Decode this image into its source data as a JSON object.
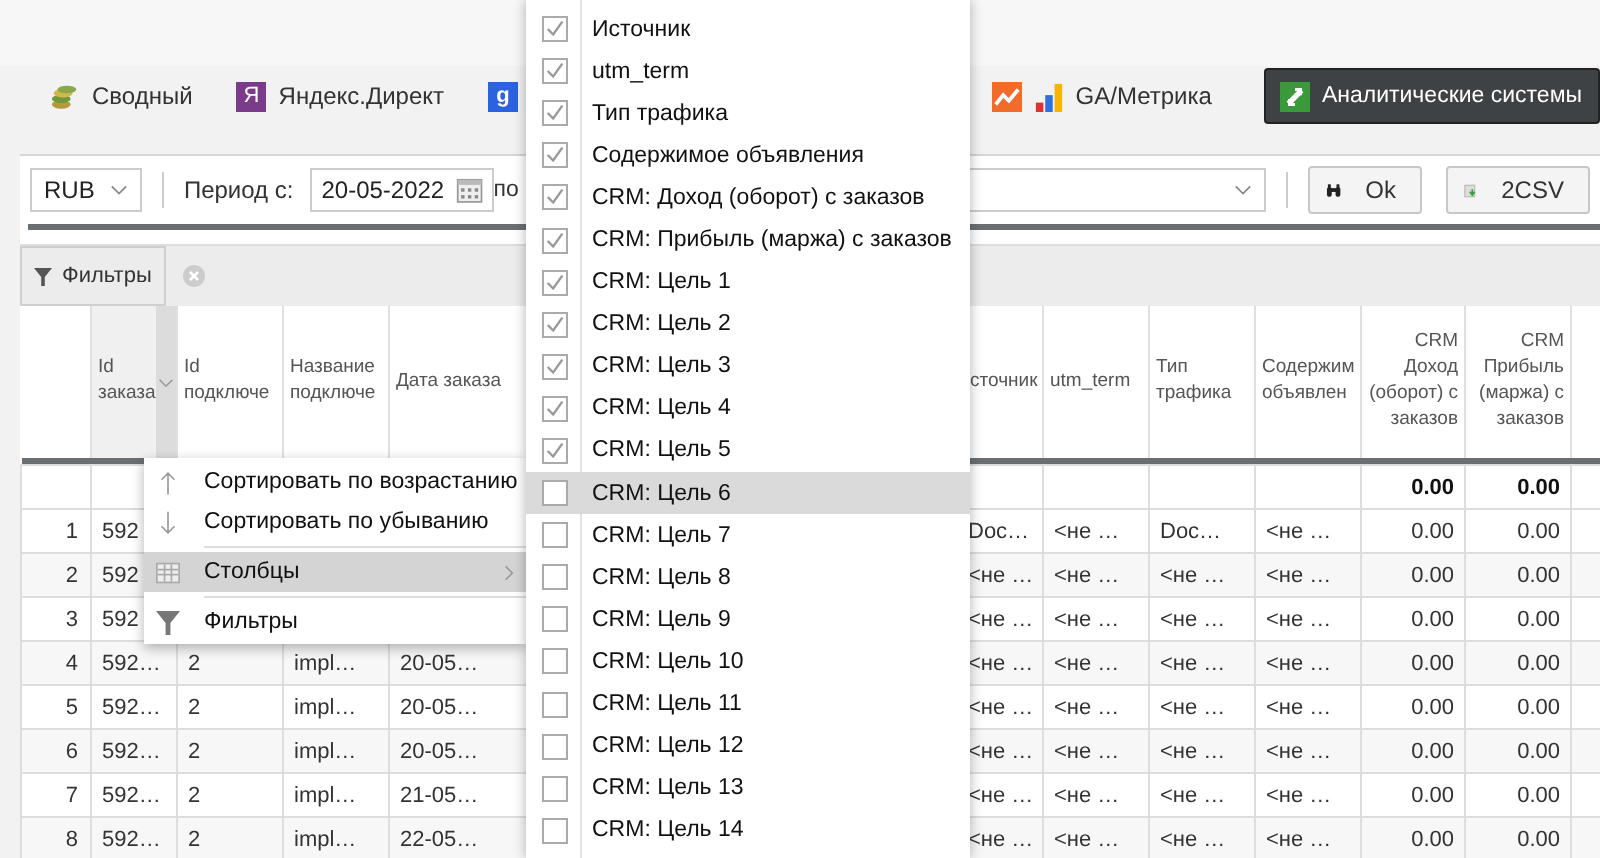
{
  "tabs": [
    {
      "kind": "coins",
      "label": "Сводный",
      "selected": false
    },
    {
      "kind": "yandex",
      "badge": "Я",
      "label": "Яндекс.Директ",
      "selected": false
    },
    {
      "kind": "google",
      "badge": "g",
      "selected": false
    },
    {
      "kind": "ga",
      "label": "GA/Метрика",
      "selected": false
    },
    {
      "kind": "analytics",
      "label": "Аналитические системы",
      "selected": true
    }
  ],
  "toolbar": {
    "currency": "RUB",
    "period_label": "Период с:",
    "date_from": "20-05-2022",
    "to_label": "по",
    "ok": "Ok",
    "csv": "2CSV"
  },
  "filters_button": "Фильтры",
  "table": {
    "columns": [
      "",
      "Id заказа",
      "Id подключе",
      "Название подключе",
      "Дата заказа",
      "сточник",
      "utm_term",
      "Тип трафика",
      "Содержим объявлен",
      "CRM Доход (оборот) с заказов",
      "CRM Прибыль (маржа) с заказов"
    ],
    "summary": {
      "revenue": "0.00",
      "profit": "0.00"
    },
    "rows": [
      [
        "1",
        "592",
        null,
        null,
        null,
        "Doc…",
        "<не …",
        "Doc…",
        "<не …",
        "0.00",
        "0.00"
      ],
      [
        "2",
        "592",
        null,
        null,
        null,
        "<не …",
        "<не …",
        "<не …",
        "<не …",
        "0.00",
        "0.00"
      ],
      [
        "3",
        "592",
        null,
        null,
        null,
        "<не …",
        "<не …",
        "<не …",
        "<не …",
        "0.00",
        "0.00"
      ],
      [
        "4",
        "592…",
        "2",
        "impl…",
        "20-05…",
        "<не …",
        "<не …",
        "<не …",
        "<не …",
        "0.00",
        "0.00"
      ],
      [
        "5",
        "592…",
        "2",
        "impl…",
        "20-05…",
        "<не …",
        "<не …",
        "<не …",
        "<не …",
        "0.00",
        "0.00"
      ],
      [
        "6",
        "592…",
        "2",
        "impl…",
        "20-05…",
        "<не …",
        "<не …",
        "<не …",
        "<не …",
        "0.00",
        "0.00"
      ],
      [
        "7",
        "592…",
        "2",
        "impl…",
        "21-05…",
        "<не …",
        "<не …",
        "<не …",
        "<не …",
        "0.00",
        "0.00"
      ],
      [
        "8",
        "592…",
        "2",
        "impl…",
        "22-05…",
        "<не …",
        "<не …",
        "<не …",
        "<не …",
        "0.00",
        "0.00"
      ]
    ]
  },
  "context_menu": [
    {
      "kind": "sort-asc",
      "label": "Сортировать по возрастанию",
      "selected": false
    },
    {
      "kind": "sort-desc",
      "label": "Сортировать по убыванию",
      "selected": false
    },
    {
      "kind": "columns",
      "label": "Столбцы",
      "selected": true
    },
    {
      "kind": "filter",
      "label": "Фильтры",
      "selected": false
    }
  ],
  "columns_menu": [
    {
      "label": "Источник",
      "checked": true,
      "selected": false
    },
    {
      "label": "utm_term",
      "checked": true,
      "selected": false
    },
    {
      "label": "Тип трафика",
      "checked": true,
      "selected": false
    },
    {
      "label": "Содержимое объявления",
      "checked": true,
      "selected": false
    },
    {
      "label": "CRM: Доход (оборот) с заказов",
      "checked": true,
      "selected": false
    },
    {
      "label": "CRM: Прибыль (маржа) с заказов",
      "checked": true,
      "selected": false
    },
    {
      "label": "CRM: Цель 1",
      "checked": true,
      "selected": false
    },
    {
      "label": "CRM: Цель 2",
      "checked": true,
      "selected": false
    },
    {
      "label": "CRM: Цель 3",
      "checked": true,
      "selected": false
    },
    {
      "label": "CRM: Цель 4",
      "checked": true,
      "selected": false
    },
    {
      "label": "CRM: Цель 5",
      "checked": true,
      "selected": false
    },
    {
      "label": "CRM: Цель 6",
      "checked": false,
      "selected": true
    },
    {
      "label": "CRM: Цель 7",
      "checked": false,
      "selected": false
    },
    {
      "label": "CRM: Цель 8",
      "checked": false,
      "selected": false
    },
    {
      "label": "CRM: Цель 9",
      "checked": false,
      "selected": false
    },
    {
      "label": "CRM: Цель 10",
      "checked": false,
      "selected": false
    },
    {
      "label": "CRM: Цель 11",
      "checked": false,
      "selected": false
    },
    {
      "label": "CRM: Цель 12",
      "checked": false,
      "selected": false
    },
    {
      "label": "CRM: Цель 13",
      "checked": false,
      "selected": false
    },
    {
      "label": "CRM: Цель 14",
      "checked": false,
      "selected": false
    }
  ]
}
